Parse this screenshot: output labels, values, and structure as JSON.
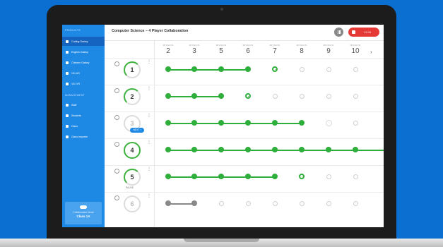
{
  "sidebar": {
    "products_heading": "PRODUCTS",
    "products": [
      {
        "label": "Coding Galaxy",
        "active": true
      },
      {
        "label": "English Galaxy",
        "active": false
      },
      {
        "label": "Chinese Galaxy",
        "active": false
      },
      {
        "label": "101 AR",
        "active": false
      },
      {
        "label": "101 VR",
        "active": false
      }
    ],
    "management_heading": "MANAGEMENT",
    "management": [
      {
        "label": "Staff"
      },
      {
        "label": "Students"
      },
      {
        "label": "Class"
      },
      {
        "label": "Class Importer"
      }
    ],
    "collab_mode_label": "Collaboration Mode",
    "collab_class": "Class 1A"
  },
  "header": {
    "title": "Computer Science  –  4 Player Collaboration",
    "timer": "12:34"
  },
  "missions": {
    "label": "MISSION",
    "numbers": [
      "2",
      "3",
      "5",
      "6",
      "7",
      "8",
      "9",
      "10"
    ]
  },
  "teams": [
    {
      "number": "1",
      "ring": "partial",
      "badge": "",
      "note": "",
      "done": 4,
      "current": 4,
      "grey": 0
    },
    {
      "number": "2",
      "ring": "partial",
      "badge": "",
      "note": "",
      "done": 3,
      "current": 3,
      "grey": 0
    },
    {
      "number": "3",
      "ring": "none",
      "badge": "NEXT",
      "note": "",
      "done": 6,
      "current": -1,
      "grey": 0,
      "ghost": 6
    },
    {
      "number": "4",
      "ring": "full",
      "badge": "",
      "note": "",
      "done": 8,
      "current": -1,
      "grey": 0,
      "full_line": true
    },
    {
      "number": "5",
      "ring": "partial",
      "badge": "",
      "note": "PAUSE",
      "done": 5,
      "current": 5,
      "grey": 0
    },
    {
      "number": "6",
      "ring": "none",
      "badge": "",
      "note": "",
      "done": 0,
      "current": -1,
      "grey": 2
    }
  ],
  "colors": {
    "accent": "#1e88e5",
    "progress": "#2eae3a",
    "stop": "#e53935",
    "background": "#0a6fd0"
  }
}
